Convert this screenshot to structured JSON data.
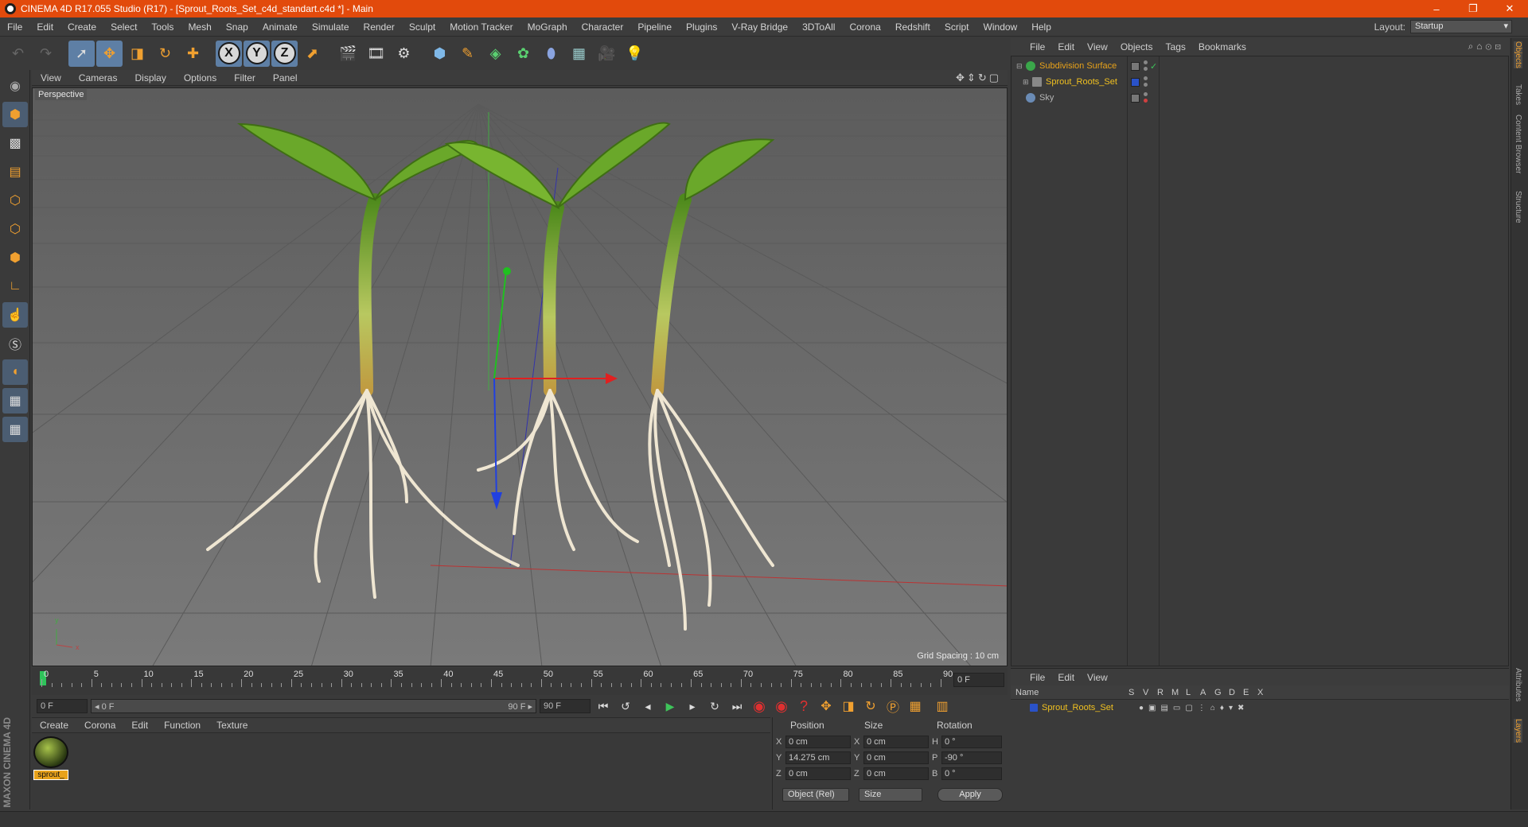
{
  "window": {
    "title": "CINEMA 4D R17.055 Studio (R17) - [Sprout_Roots_Set_c4d_standart.c4d *] - Main",
    "controls": [
      "–",
      "❐",
      "✕"
    ]
  },
  "menu": [
    "File",
    "Edit",
    "Create",
    "Select",
    "Tools",
    "Mesh",
    "Snap",
    "Animate",
    "Simulate",
    "Render",
    "Sculpt",
    "Motion Tracker",
    "MoGraph",
    "Character",
    "Pipeline",
    "Plugins",
    "V-Ray Bridge",
    "3DToAll",
    "Corona",
    "Redshift",
    "Script",
    "Window",
    "Help"
  ],
  "layout": {
    "label": "Layout:",
    "value": "Startup"
  },
  "toolbar": {
    "icons": [
      "undo-icon",
      "redo-icon",
      "live-selection-icon",
      "move-icon",
      "scale-icon",
      "rotate-icon",
      "last-tool-icon",
      "x-axis-icon",
      "y-axis-icon",
      "z-axis-icon",
      "coordinate-system-icon",
      "render-view-icon",
      "render-picture-viewer-icon",
      "edit-render-settings-icon",
      "cube-icon",
      "pen-icon",
      "subdivision-icon",
      "cloner-icon",
      "deformer-icon",
      "floor-icon",
      "camera-icon",
      "light-icon"
    ],
    "axis_labels": [
      "X",
      "Y",
      "Z"
    ]
  },
  "lefttools": [
    "make-editable-icon",
    "model-mode-icon",
    "texture-mode-icon",
    "workplane-icon",
    "points-mode-icon",
    "edges-mode-icon",
    "polygons-mode-icon",
    "axis-mode-icon",
    "tweak-icon",
    "solo-icon",
    "snap-icon",
    "workplane-lock-icon",
    "locked-workplane-icon"
  ],
  "viewport": {
    "menu": [
      "View",
      "Cameras",
      "Display",
      "Options",
      "Filter",
      "Panel"
    ],
    "label": "Perspective",
    "grid_spacing": "Grid Spacing : 10 cm",
    "axis_x": "x",
    "axis_y": "y",
    "bg_color": "#6e6e6e"
  },
  "timeline": {
    "ticks": [
      "0",
      "5",
      "10",
      "15",
      "20",
      "25",
      "30",
      "35",
      "40",
      "45",
      "50",
      "55",
      "60",
      "65",
      "70",
      "75",
      "80",
      "85",
      "90"
    ],
    "frame_end_field": "0 F",
    "start_field": "0 F",
    "range_start": "◂ 0 F",
    "range_end": "90 F ▸",
    "end_field": "90 F"
  },
  "material_manager": {
    "menu": [
      "Create",
      "Corona",
      "Edit",
      "Function",
      "Texture"
    ],
    "material_name": "sprout_"
  },
  "coordinates": {
    "headers": [
      "Position",
      "Size",
      "Rotation"
    ],
    "rows": [
      {
        "pa": "X",
        "pv": "0 cm",
        "sa": "X",
        "sv": "0 cm",
        "ra": "H",
        "rv": "0 °"
      },
      {
        "pa": "Y",
        "pv": "14.275 cm",
        "sa": "Y",
        "sv": "0 cm",
        "ra": "P",
        "rv": "-90 °"
      },
      {
        "pa": "Z",
        "pv": "0 cm",
        "sa": "Z",
        "sv": "0 cm",
        "ra": "B",
        "rv": "0 °"
      }
    ],
    "mode": "Object (Rel)",
    "size_mode": "Size",
    "apply": "Apply"
  },
  "object_manager": {
    "menu": [
      "File",
      "Edit",
      "View",
      "Objects",
      "Tags",
      "Bookmarks"
    ],
    "objects": [
      {
        "name": "Subdivision Surface",
        "color": "#e8a21a",
        "icon_color": "#3aa64a"
      },
      {
        "name": "Sprout_Roots_Set",
        "color": "#f0c020",
        "icon_color": "#888888"
      },
      {
        "name": "Sky",
        "color": "#b5b5b5",
        "icon_color": "#6a8bb5"
      }
    ]
  },
  "layer_manager": {
    "menu": [
      "File",
      "Edit",
      "View"
    ],
    "headers": [
      "Name",
      "S",
      "V",
      "R",
      "M",
      "L",
      "A",
      "G",
      "D",
      "E",
      "X"
    ],
    "layers": [
      {
        "name": "Sprout_Roots_Set",
        "color": "#f0c020"
      }
    ]
  },
  "vertical_tabs": [
    "Objects",
    "Takes",
    "Content Browser",
    "Structure",
    "Attributes",
    "Layers"
  ],
  "brand": "MAXON CINEMA 4D"
}
